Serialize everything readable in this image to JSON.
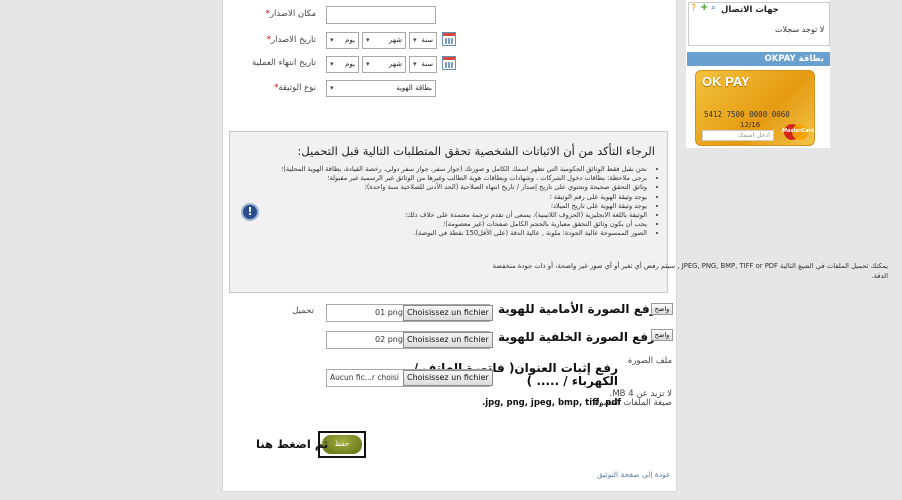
{
  "form": {
    "issue_place_label": "مكان الاصدار",
    "issue_date_label": "تاريخ الاصدار",
    "expiry_date_label": "تاريخ انتهاء العملية",
    "doc_type_label": "نوع الوثيقة",
    "required_mark": "*",
    "year_select": "سنة",
    "month_select": "شهر",
    "day_select": "يوم",
    "doc_type_value": "بطاقة الهوية"
  },
  "info": {
    "title": "الرجاء التأكد من أن الاثباتات الشخصية تحقق المتطلبات التالية قبل التحميل:",
    "items": [
      "نحن نقبل فقط الوثائق الحكومية التي تظهر اسمك الكامل و صورتك (جواز سفر، جواز سفر دولي، رخصة القيادة، بطاقة الهوية المحلية)؛",
      "برجى ملاحظة: بطاقات دخول الشركات ، وشهادات وبطاقات هوية الطالب وغيرها من الوثائق غير الرسمية غير مقبولة؛",
      "وثائق التحقق صحيحة وتحتوي على تاريخ إصدار / تاريخ انتهاء الصلاحية (الحد الأدنى للصلاحية سنة واحدة)؛",
      "يوجد وثيقة الهوية على رقم الوثيقة ؛",
      "يوجد وثيقة الهوية على تاريخ الميلاد؛",
      "الوثيقة باللغة الانجليزية (الحروف اللاتينية)، يسعى أن تقدم ترجمة معتمدة على خلاف ذلك؛",
      "يجب أن يكون وثائق التحقق معيارية بالحجم الكامل صفحات (غير معصومة)؛",
      "الصور الممسوحة عالية الجودة: ملونة , عالية الدقة (على الأقل150 نقطة في البوصة)."
    ],
    "note": "يمكنك تحميل الملفات في الصيغ التالية JPEG, PNG, BMP, TIFF or PDF , سيتم رفض أي تغير أو أي صور غير واضحة، أو ذات جودة منخفضة الدقة.",
    "icon_glyph": "!"
  },
  "uploads": {
    "section_label": "تحميل",
    "proof_label": "ملف الصورة",
    "front_title": "رفع الصورة الأمامية للهوية",
    "back_title": "رفع الصورة الخلفية للهوية",
    "address_title": "رفع إثبات العنوان( فاتورة الهاتف / الكهرباء / ..... )",
    "front_value": "01 png",
    "back_value": "02 png",
    "address_value": "Aucun fic...r choisi",
    "choose_label": "Choisissez un fichier",
    "show_label": "واضح",
    "max_size": "لا تزيد عن 4 MB.",
    "formats_label": "صيغة الملفات المقبولة:",
    "formats": ".jpg, png, jpeg, bmp, tiff, pdf"
  },
  "save": {
    "label": "حفظ",
    "hint": "ثم اضغط هنا"
  },
  "back_link": "عودة إلى صفحة التوثيق",
  "sidebar": {
    "contact_label": "جهات الاتصال",
    "no_records": "لا توجد سجلات",
    "okpay_title": "بطاقة OKPAY",
    "card_brand": "OK PAY",
    "card_number": "5412 7500 0000 0060",
    "card_expiry": "12/16",
    "card_name_placeholder": "ادخل اسمك",
    "card_network": "MasterCard"
  }
}
